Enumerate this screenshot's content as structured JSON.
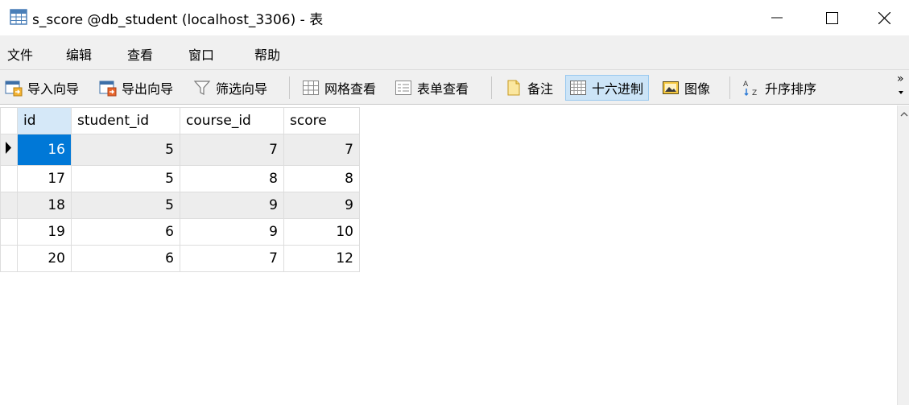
{
  "window": {
    "title": "s_score @db_student (localhost_3306) - 表"
  },
  "menu": [
    "文件",
    "编辑",
    "查看",
    "窗口",
    "帮助"
  ],
  "toolbar": {
    "import_wizard": "导入向导",
    "export_wizard": "导出向导",
    "filter_wizard": "筛选向导",
    "grid_view": "网格查看",
    "form_view": "表单查看",
    "memo": "备注",
    "hex": "十六进制",
    "image": "图像",
    "sort_asc": "升序排序",
    "more": "»"
  },
  "grid": {
    "columns": [
      "id",
      "student_id",
      "course_id",
      "score"
    ],
    "rows": [
      [
        "16",
        "5",
        "7",
        "7"
      ],
      [
        "17",
        "5",
        "8",
        "8"
      ],
      [
        "18",
        "5",
        "9",
        "9"
      ],
      [
        "19",
        "6",
        "9",
        "10"
      ],
      [
        "20",
        "6",
        "7",
        "12"
      ]
    ]
  },
  "colors": {
    "selection": "#0078d7",
    "selected_header": "#d5e8f8",
    "toolbar_active": "#cce4f7"
  }
}
